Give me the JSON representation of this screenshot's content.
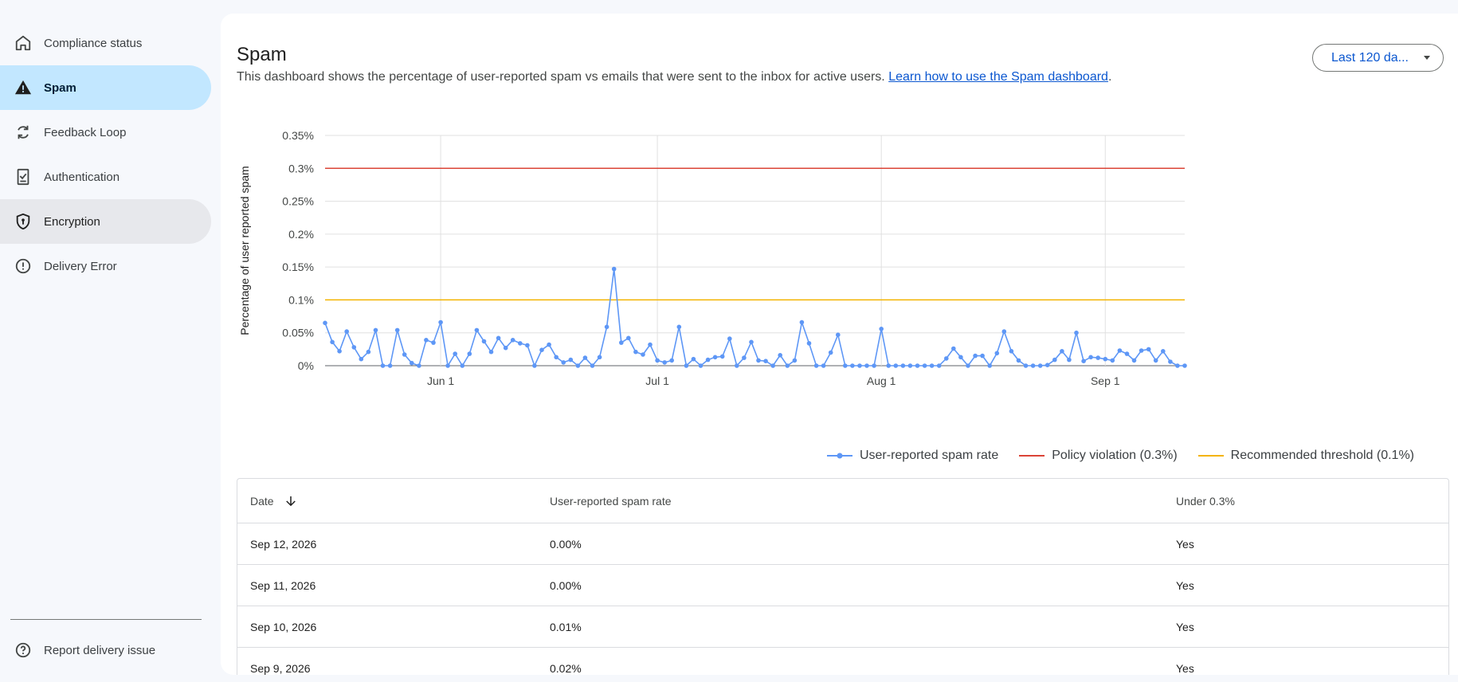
{
  "sidebar": {
    "items": [
      {
        "label": "Compliance status",
        "icon": "home-icon"
      },
      {
        "label": "Spam",
        "icon": "warning-icon"
      },
      {
        "label": "Feedback Loop",
        "icon": "sync-icon"
      },
      {
        "label": "Authentication",
        "icon": "checklist-icon"
      },
      {
        "label": "Encryption",
        "icon": "shield-icon"
      },
      {
        "label": "Delivery Error",
        "icon": "error-icon"
      }
    ],
    "footer_label": "Report delivery issue"
  },
  "header": {
    "title": "Spam",
    "description": "This dashboard shows the percentage of user-reported spam vs emails that were sent to the inbox for active users.",
    "link_text": "Learn how to use the Spam dashboard",
    "range_button": "Last 120 da..."
  },
  "colors": {
    "series": "#5e97f6",
    "policy": "#db4437",
    "threshold": "#f4b400",
    "active_nav": "#c2e7ff",
    "link": "#0b57d0"
  },
  "chart_data": {
    "type": "line",
    "ylabel": "Percentage of user reported spam",
    "ylim": [
      0,
      0.35
    ],
    "y_ticks": [
      "0%",
      "0.05%",
      "0.1%",
      "0.15%",
      "0.2%",
      "0.25%",
      "0.3%",
      "0.35%"
    ],
    "x_range": [
      "2026-05-16",
      "2026-09-12"
    ],
    "x_ticks": [
      {
        "label": "Jun 1",
        "date": "2026-06-01"
      },
      {
        "label": "Jul 1",
        "date": "2026-07-01"
      },
      {
        "label": "Aug 1",
        "date": "2026-08-01"
      },
      {
        "label": "Sep 1",
        "date": "2026-09-01"
      }
    ],
    "series": [
      {
        "name": "User-reported spam rate",
        "values": [
          0.065,
          0.036,
          0.022,
          0.052,
          0.028,
          0.01,
          0.021,
          0.054,
          0,
          0,
          0.054,
          0.017,
          0.004,
          0,
          0.039,
          0.035,
          0.066,
          0,
          0.018,
          0,
          0.018,
          0.054,
          0.037,
          0.021,
          0.042,
          0.027,
          0.039,
          0.034,
          0.031,
          0,
          0.024,
          0.032,
          0.013,
          0.005,
          0.009,
          0,
          0.012,
          0,
          0.013,
          0.059,
          0.147,
          0.035,
          0.042,
          0.021,
          0.017,
          0.032,
          0.008,
          0.005,
          0.008,
          0.059,
          0,
          0.01,
          0,
          0.009,
          0.013,
          0.014,
          0.041,
          0,
          0.012,
          0.036,
          0.008,
          0.007,
          0,
          0.016,
          0,
          0.008,
          0.066,
          0.034,
          0,
          0,
          0.02,
          0.047,
          0,
          0,
          0,
          0,
          0,
          0.056,
          0,
          0,
          0,
          0,
          0,
          0,
          0,
          0,
          0.011,
          0.026,
          0.013,
          0,
          0.015,
          0.015,
          0,
          0.019,
          0.052,
          0.022,
          0.008,
          0,
          0,
          0,
          0.001,
          0.009,
          0.022,
          0.009,
          0.05,
          0.007,
          0.013,
          0.012,
          0.01,
          0.008,
          0.023,
          0.018,
          0.008,
          0.023,
          0.025,
          0.008,
          0.022,
          0.006,
          0,
          0
        ]
      },
      {
        "name": "Policy violation (0.3%)",
        "constant": 0.3
      },
      {
        "name": "Recommended threshold (0.1%)",
        "constant": 0.1
      }
    ],
    "legend_position": "bottom-right",
    "grid": true
  },
  "table": {
    "columns": [
      "Date",
      "User-reported spam rate",
      "Under 0.3%"
    ],
    "rows": [
      [
        "Sep 12, 2026",
        "0.00%",
        "Yes"
      ],
      [
        "Sep 11, 2026",
        "0.00%",
        "Yes"
      ],
      [
        "Sep 10, 2026",
        "0.01%",
        "Yes"
      ],
      [
        "Sep 9, 2026",
        "0.02%",
        "Yes"
      ]
    ]
  }
}
